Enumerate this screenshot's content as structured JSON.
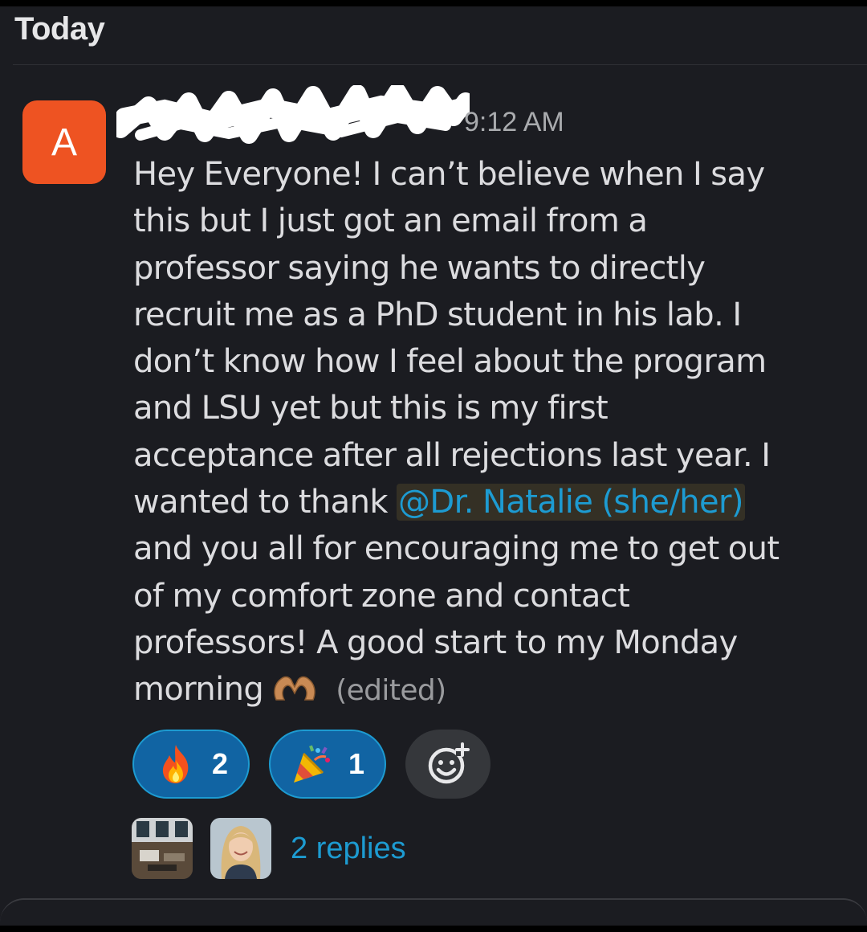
{
  "day_header": "Today",
  "message": {
    "avatar_letter": "A",
    "timestamp": "9:12 AM",
    "lines": [
      "Hey Everyone! I can’t believe when I say",
      "this but I just got an email from a",
      "professor saying he wants to directly",
      "recruit me as a PhD student in his lab. I",
      "don’t know how I feel about the program",
      "and LSU yet but this is my first",
      "acceptance after all rejections last year. I"
    ],
    "line8_prefix": "wanted to thank ",
    "mention": "@Dr. Natalie (she/her)",
    "lines_after": [
      "and you all for encouraging me to get out",
      "of my comfort zone and contact",
      "professors! A good start to my Monday"
    ],
    "last_line": "morning",
    "emoji_icon": "heart-hands-icon",
    "edited_label": "(edited)"
  },
  "reactions": [
    {
      "icon": "fire-emoji",
      "count": "2"
    },
    {
      "icon": "party-popper-emoji",
      "count": "1"
    }
  ],
  "thread": {
    "replies_label": "2 replies"
  },
  "colors": {
    "background": "#1b1c21",
    "avatar": "#ee5322",
    "link": "#1d9bd1",
    "reaction_bg": "#1164a3"
  }
}
